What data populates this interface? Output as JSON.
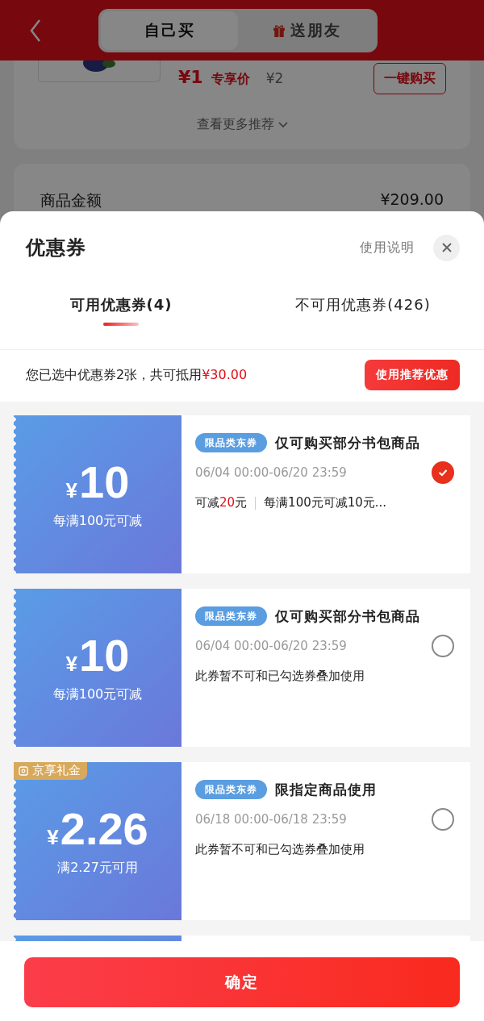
{
  "header": {
    "tabs": [
      {
        "label": "自己买",
        "selected": true
      },
      {
        "label": "送朋友",
        "selected": false
      }
    ]
  },
  "product": {
    "price": "¥1",
    "price_label": "专享价",
    "original_price": "¥2",
    "buy_button": "一键购买",
    "more": "查看更多推荐"
  },
  "summary": {
    "label": "商品金额",
    "value": "¥209.00"
  },
  "sheet": {
    "title": "优惠券",
    "help": "使用说明",
    "tabs": [
      {
        "label": "可用优惠券(4)",
        "selected": true
      },
      {
        "label": "不可用优惠券(426)",
        "selected": false
      }
    ],
    "selection": {
      "text": "您已选中优惠券2张，共可抵用",
      "amount": "¥30.00",
      "button": "使用推荐优惠"
    },
    "coupons": [
      {
        "currency": "¥",
        "amount": "10",
        "condition": "每满100元可减",
        "tag": "限品类东券",
        "title": "仅可购买部分书包商品",
        "validity": "06/04 00:00-06/20 23:59",
        "note": {
          "kind": "saving",
          "prefix": "可减",
          "amount": "20",
          "suffix": "元",
          "rule": "每满100元可减10元..."
        },
        "selected": true
      },
      {
        "currency": "¥",
        "amount": "10",
        "condition": "每满100元可减",
        "tag": "限品类东券",
        "title": "仅可购买部分书包商品",
        "validity": "06/04 00:00-06/20 23:59",
        "note": {
          "kind": "notice",
          "text": "此券暂不可和已勾选券叠加使用"
        },
        "selected": false
      },
      {
        "currency": "¥",
        "amount": "2.26",
        "condition": "满2.27元可用",
        "badge": "京享礼金",
        "tag": "限品类东券",
        "title": "限指定商品使用",
        "validity": "06/18 00:00-06/18 23:59",
        "note": {
          "kind": "notice",
          "text": "此券暂不可和已勾选券叠加使用"
        },
        "selected": false
      }
    ],
    "confirm": "确定"
  }
}
